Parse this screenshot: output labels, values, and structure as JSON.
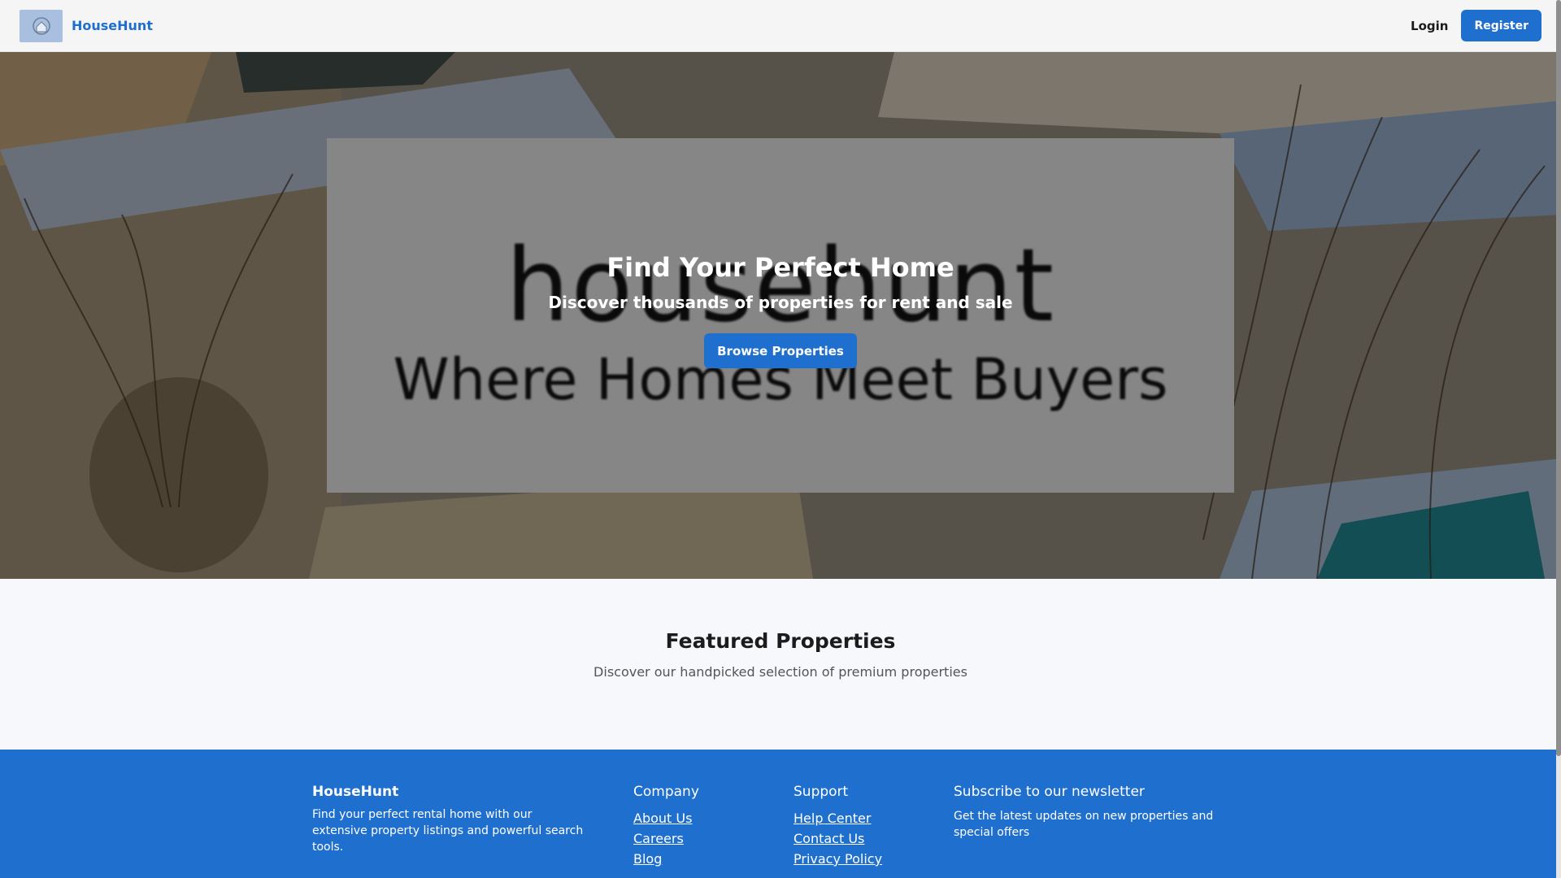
{
  "navbar": {
    "brand_name": "HouseHunt",
    "logo_icon": "house-logo-icon",
    "login_label": "Login",
    "register_label": "Register"
  },
  "hero": {
    "title": "Find Your Perfect Home",
    "subtitle": "Discover thousands of properties for rent and sale",
    "cta_label": "Browse Properties",
    "background_image_text": {
      "logo_word": "househunt",
      "tagline": "Where Homes Meet Buyers"
    }
  },
  "featured": {
    "title": "Featured Properties",
    "subtitle": "Discover our handpicked selection of premium properties"
  },
  "footer": {
    "brand": {
      "title": "HouseHunt",
      "description": "Find your perfect rental home with our extensive property listings and powerful search tools."
    },
    "company": {
      "title": "Company",
      "links": [
        "About Us",
        "Careers",
        "Blog"
      ]
    },
    "support": {
      "title": "Support",
      "links": [
        "Help Center",
        "Contact Us",
        "Privacy Policy"
      ]
    },
    "newsletter": {
      "title": "Subscribe to our newsletter",
      "text": "Get the latest updates on new properties and special offers"
    }
  },
  "colors": {
    "primary": "#1f6fcf",
    "nav_bg": "#f5f5f5",
    "page_bg": "#f7f8fb"
  }
}
